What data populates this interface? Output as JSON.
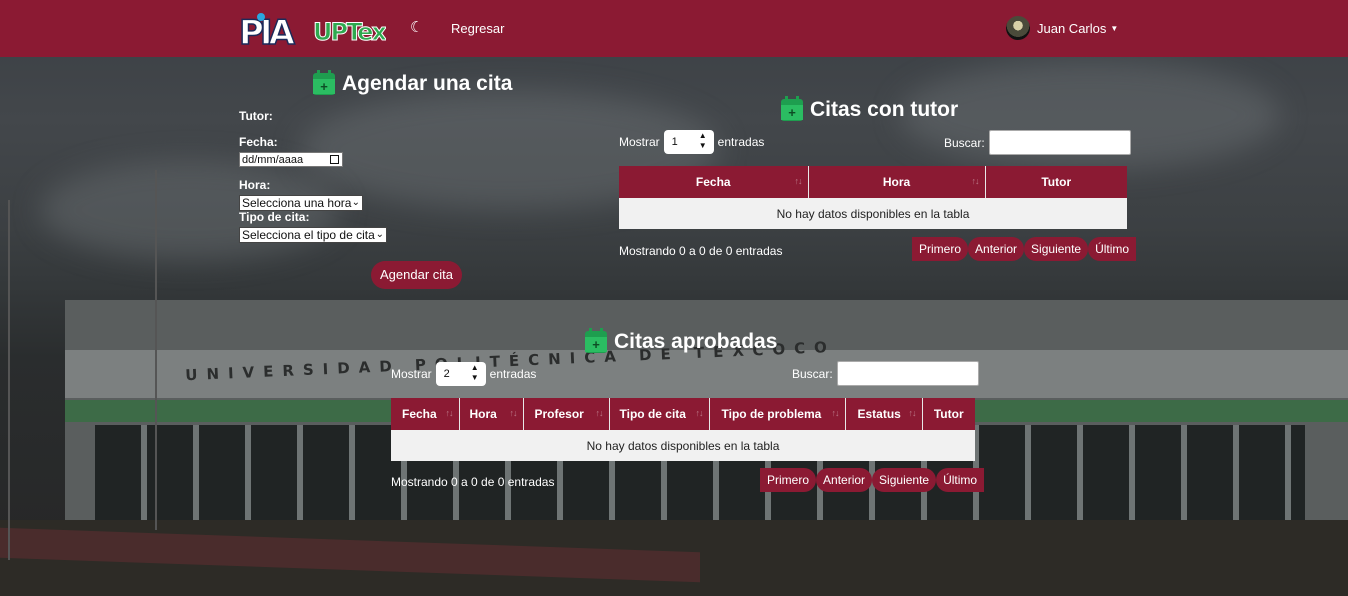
{
  "navbar": {
    "logo_pia": "PIA",
    "logo_upt": "UPTex",
    "back_link": "Regresar",
    "user_name": "Juan Carlos",
    "colors": {
      "primary": "#8b1a33"
    }
  },
  "background": {
    "building_text": "UNIVERSIDAD POLITÉCNICA DE TEXCOCO"
  },
  "schedule_form": {
    "title": "Agendar una cita",
    "tutor_label": "Tutor:",
    "date_label": "Fecha:",
    "date_placeholder": "dd/mm/aaaa",
    "time_label": "Hora:",
    "time_select": "Selecciona una hora",
    "type_label": "Tipo de cita:",
    "type_select": "Selecciona el tipo de cita",
    "submit": "Agendar cita"
  },
  "tutor_appointments": {
    "title": "Citas con tutor",
    "length_prefix": "Mostrar",
    "length_value": "1",
    "length_suffix": "entradas",
    "search_label": "Buscar:",
    "columns": [
      "Fecha",
      "Hora",
      "Tutor"
    ],
    "empty_message": "No hay datos disponibles en la tabla",
    "info": "Mostrando 0 a 0 de 0 entradas",
    "pager": [
      "Primero",
      "Anterior",
      "Siguiente",
      "Último"
    ]
  },
  "approved_appointments": {
    "title": "Citas aprobadas",
    "length_prefix": "Mostrar",
    "length_value": "2",
    "length_suffix": "entradas",
    "search_label": "Buscar:",
    "columns": [
      "Fecha",
      "Hora",
      "Profesor",
      "Tipo de cita",
      "Tipo de problema",
      "Estatus",
      "Tutor"
    ],
    "empty_message": "No hay datos disponibles en la tabla",
    "info": "Mostrando 0 a 0 de 0 entradas",
    "pager": [
      "Primero",
      "Anterior",
      "Siguiente",
      "Último"
    ]
  }
}
